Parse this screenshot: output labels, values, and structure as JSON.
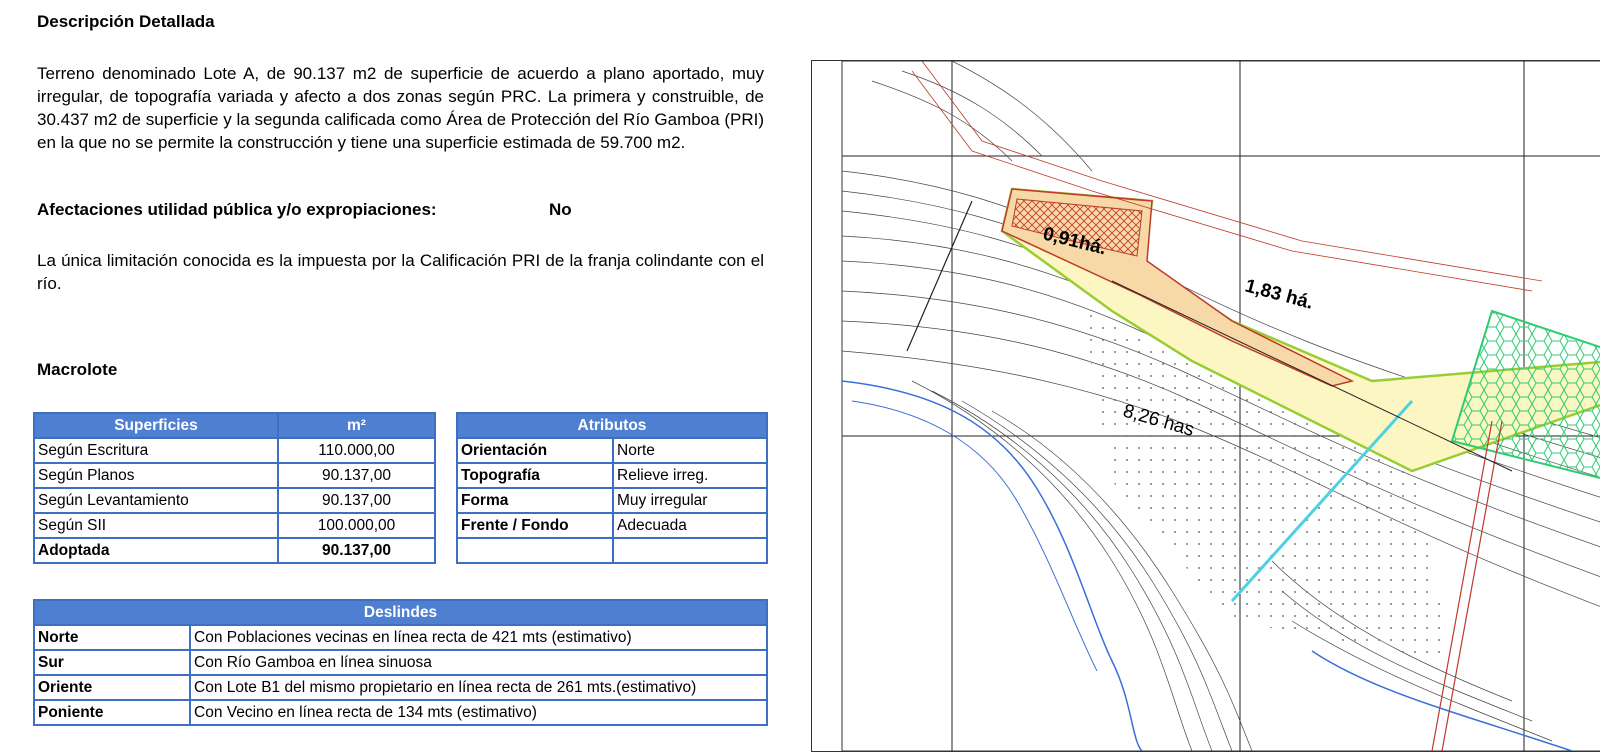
{
  "descripcion": {
    "heading": "Descripción Detallada",
    "text": "Terreno denominado Lote A,  de 90.137 m2 de superficie de acuerdo a plano aportado, muy irregular, de topografía variada y afecto a dos zonas según PRC. La primera y construible, de 30.437 m2 de superficie y la segunda calificada como Área de Protección del Río Gamboa (PRI) en la que no se permite la construcción y tiene una superficie estimada de 59.700 m2."
  },
  "afectaciones": {
    "label": "Afectaciones utilidad pública y/o expropiaciones:",
    "value": "No",
    "text": "La única limitación conocida es la impuesta por la Calificación PRI de la franja colindante con el río."
  },
  "macrolote": {
    "heading": "Macrolote"
  },
  "superficies": {
    "headers": [
      "Superficies",
      "m²"
    ],
    "rows": [
      [
        "Según Escritura",
        "110.000,00"
      ],
      [
        "Según Planos",
        "90.137,00"
      ],
      [
        "Según Levantamiento",
        "90.137,00"
      ],
      [
        "Según SII",
        "100.000,00"
      ],
      [
        "Adoptada",
        "90.137,00"
      ]
    ]
  },
  "atributos": {
    "header": "Atributos",
    "rows": [
      [
        "Orientación",
        "Norte"
      ],
      [
        "Topografía",
        "Relieve irreg."
      ],
      [
        "Forma",
        "Muy irregular"
      ],
      [
        "Frente / Fondo",
        "Adecuada"
      ],
      [
        "",
        ""
      ]
    ]
  },
  "deslindes": {
    "header": "Deslindes",
    "rows": [
      [
        "Norte",
        "Con Poblaciones vecinas en línea recta de 421 mts (estimativo)"
      ],
      [
        "Sur",
        "Con Río Gamboa en línea sinuosa"
      ],
      [
        "Oriente",
        "Con Lote B1 del mismo propietario en línea recta de 261 mts.(estimativo)"
      ],
      [
        "Poniente",
        "Con Vecino en línea recta de 134 mts (estimativo)"
      ]
    ]
  },
  "map": {
    "labels": [
      "0,91há.",
      "1,83 há.",
      "8,26 has"
    ]
  },
  "colors": {
    "table_border": "#3f6fc1",
    "table_header": "#4f7fd0"
  }
}
